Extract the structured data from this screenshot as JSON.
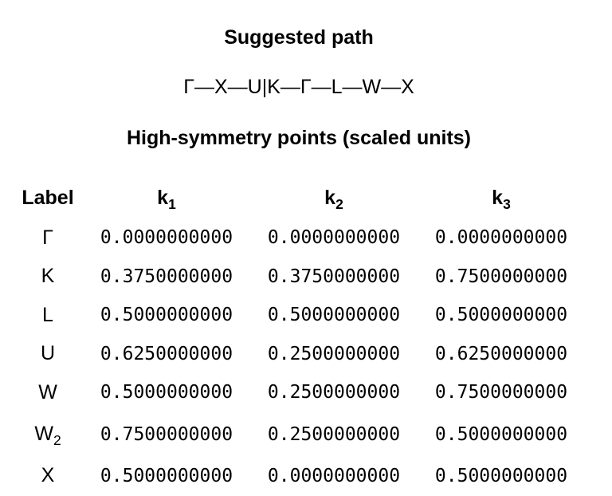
{
  "path_section": {
    "title": "Suggested path",
    "segments": [
      "Γ—X—U",
      "|",
      "K—Γ—L—W—X"
    ]
  },
  "points_section": {
    "title": "High-symmetry points (scaled units)"
  },
  "table": {
    "header": {
      "label": "Label",
      "k1": "k",
      "k1_sub": "1",
      "k2": "k",
      "k2_sub": "2",
      "k3": "k",
      "k3_sub": "3"
    },
    "rows": [
      {
        "label": "Γ",
        "label_sub": "",
        "k1": "0.0000000000",
        "k2": "0.0000000000",
        "k3": "0.0000000000"
      },
      {
        "label": "K",
        "label_sub": "",
        "k1": "0.3750000000",
        "k2": "0.3750000000",
        "k3": "0.7500000000"
      },
      {
        "label": "L",
        "label_sub": "",
        "k1": "0.5000000000",
        "k2": "0.5000000000",
        "k3": "0.5000000000"
      },
      {
        "label": "U",
        "label_sub": "",
        "k1": "0.6250000000",
        "k2": "0.2500000000",
        "k3": "0.6250000000"
      },
      {
        "label": "W",
        "label_sub": "",
        "k1": "0.5000000000",
        "k2": "0.2500000000",
        "k3": "0.7500000000"
      },
      {
        "label": "W",
        "label_sub": "2",
        "k1": "0.7500000000",
        "k2": "0.2500000000",
        "k3": "0.5000000000"
      },
      {
        "label": "X",
        "label_sub": "",
        "k1": "0.5000000000",
        "k2": "0.0000000000",
        "k3": "0.5000000000"
      }
    ]
  }
}
